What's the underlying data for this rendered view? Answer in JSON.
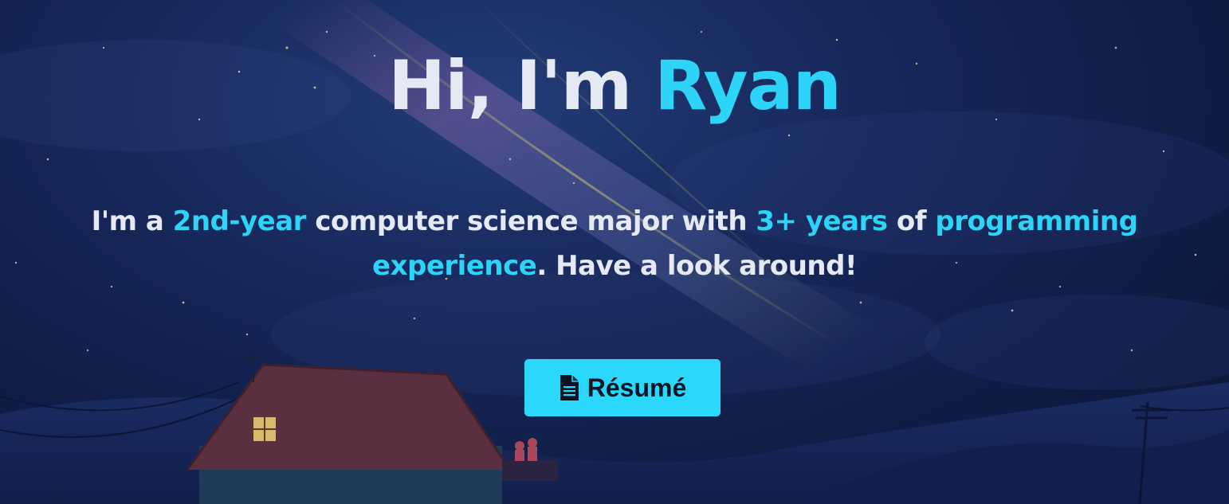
{
  "hero": {
    "greeting": "Hi, I'm ",
    "name": "Ryan",
    "intro": {
      "p1": "I'm a ",
      "h1": "2nd-year",
      "p2": " computer science major with ",
      "h2": "3+ years",
      "p3": " of ",
      "h3": "programming experience",
      "p4": ". Have a look around!"
    },
    "resume_button": {
      "icon": "file-document-icon",
      "label": "Résumé"
    }
  },
  "colors": {
    "accent": "#2dd4f7",
    "text": "#e5e9f3",
    "button": "#2bd7fb",
    "background": "#0f1c45"
  }
}
